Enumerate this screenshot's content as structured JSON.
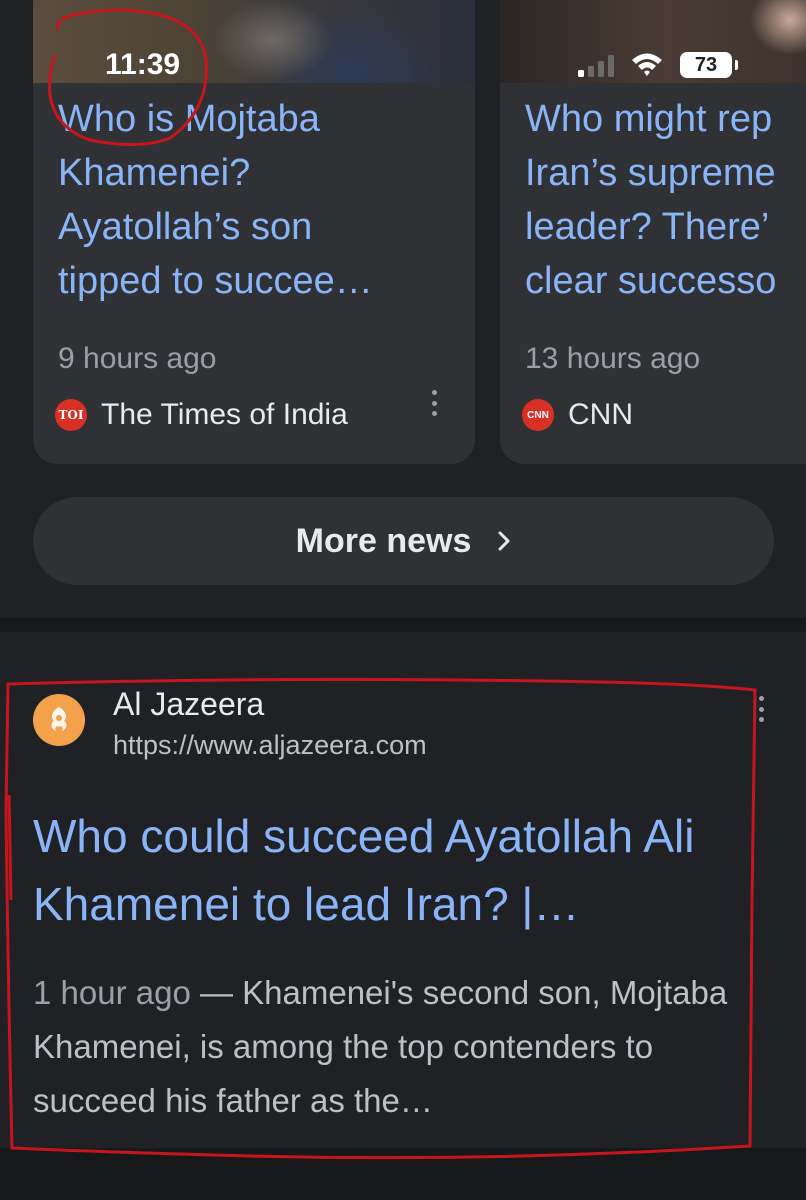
{
  "status_bar": {
    "time": "11:39",
    "battery": "73"
  },
  "news_cards": [
    {
      "title_lines": [
        "Who is Mojtaba",
        "Khamenei?",
        "Ayatollah’s son",
        "tipped to succee…"
      ],
      "time": "9 hours ago",
      "source": "The Times of India",
      "source_logo": "TOI"
    },
    {
      "title_lines": [
        "Who might rep",
        "Iran’s supreme",
        "leader? There’",
        "clear successo"
      ],
      "time": "13 hours ago",
      "source": "CNN",
      "source_logo": "CNN"
    }
  ],
  "more_news": {
    "label": "More news"
  },
  "result": {
    "site_name": "Al Jazeera",
    "site_url": "https://www.aljazeera.com",
    "title": "Who could succeed Ayatollah Ali Khamenei to lead Iran? |…",
    "date": "1 hour ago",
    "snippet": " — Khamenei's second son, Mojtaba Khamenei, is among the top contenders to succeed his father as the…"
  },
  "colors": {
    "background": "#202124",
    "card": "#303134",
    "link": "#8ab4f8",
    "annotation": "#c4161c"
  }
}
